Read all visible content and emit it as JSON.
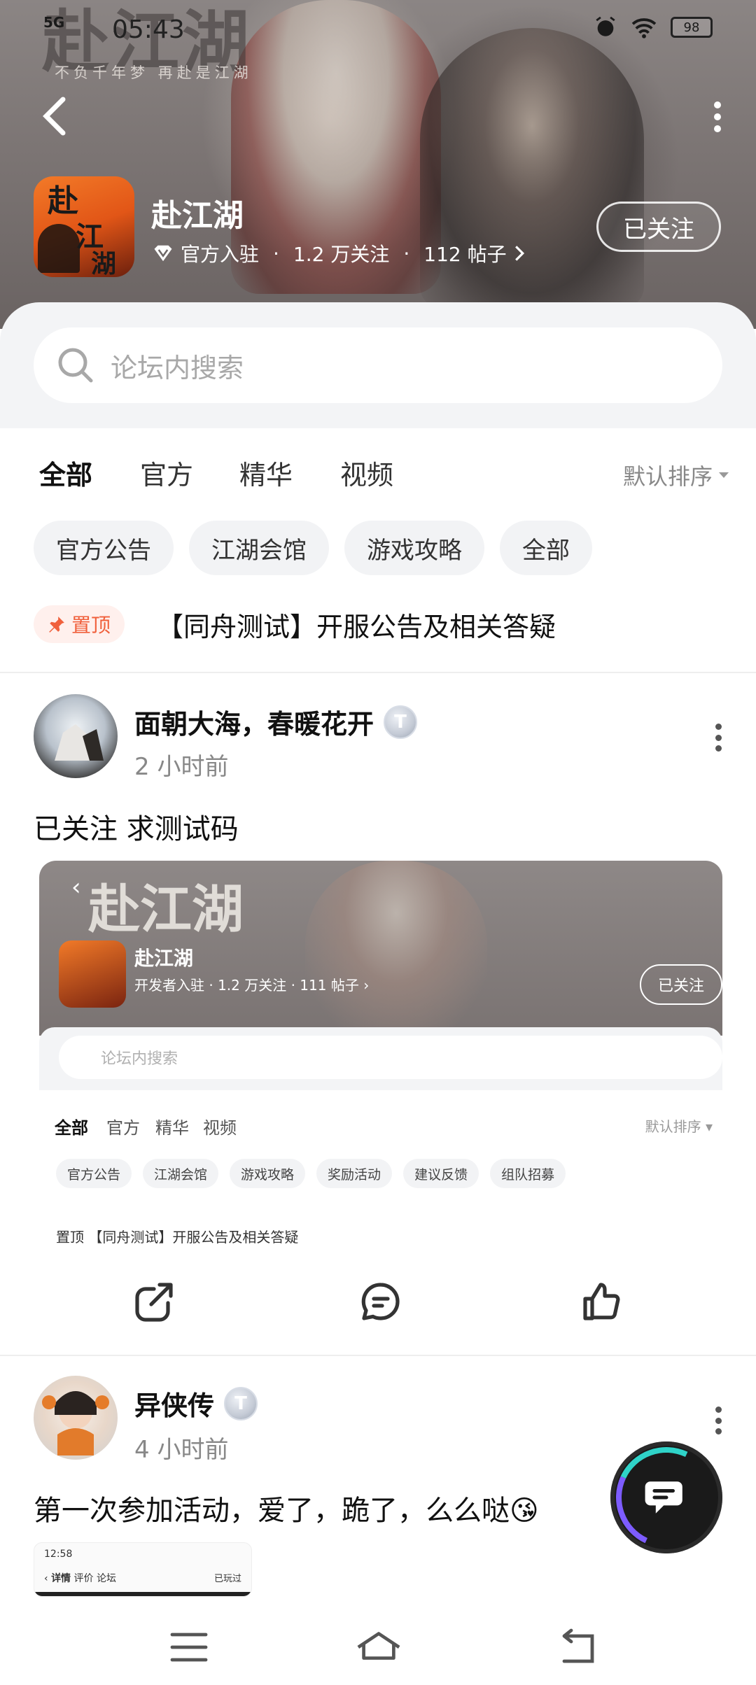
{
  "status_bar": {
    "network": "5G",
    "time": "05:43",
    "battery": "98"
  },
  "banner": {
    "logo_text": "赴江湖",
    "slogan": "不负千年梦 再赴是江湖"
  },
  "forum": {
    "app_icon_chars": [
      "赴",
      "江",
      "湖"
    ],
    "title": "赴江湖",
    "official_label": "官方入驻",
    "followers": "1.2 万关注",
    "posts": "112 帖子",
    "follow_button": "已关注"
  },
  "search": {
    "placeholder": "论坛内搜索"
  },
  "tabs": {
    "items": [
      "全部",
      "官方",
      "精华",
      "视频"
    ],
    "active": "全部",
    "sort_label": "默认排序"
  },
  "chips": [
    "官方公告",
    "江湖会馆",
    "游戏攻略",
    "全部"
  ],
  "pinned": {
    "badge": "置顶",
    "title": "【同舟测试】开服公告及相关答疑"
  },
  "posts": [
    {
      "author": "面朝大海，春暖花开",
      "badge": "T",
      "time": "2 小时前",
      "text": "已关注 求测试码",
      "screenshot": {
        "back": "‹",
        "logo": "赴江湖",
        "forum_name": "赴江湖",
        "meta": "开发者入驻 · 1.2 万关注 · 111 帖子 ›",
        "follow": "已关注",
        "search": "论坛内搜索",
        "tabs": [
          "全部",
          "官方",
          "精华",
          "视频"
        ],
        "sort": "默认排序 ▾",
        "chips": [
          "官方公告",
          "江湖会馆",
          "游戏攻略",
          "奖励活动",
          "建议反馈",
          "组队招募"
        ],
        "pinned": "置顶 【同舟测试】开服公告及相关答疑"
      }
    },
    {
      "author": "异侠传",
      "badge": "T",
      "time": "4 小时前",
      "text": "第一次参加活动，爱了，跪了，么么哒😘",
      "screenshot": {
        "time": "12:58",
        "tab_detail": "详情",
        "tab_review": "评价",
        "tab_forum": "论坛",
        "right": "已玩过"
      }
    }
  ],
  "colors": {
    "accent": "#1dc4bd",
    "pin": "#f0603c",
    "pin_bg": "#fff0ed",
    "chip_bg": "#f2f3f5",
    "search_bg": "#f3f4f6"
  },
  "icons": [
    "back-icon",
    "more-icon",
    "search-icon",
    "share-icon",
    "comment-icon",
    "like-icon",
    "chat-icon",
    "menu-icon",
    "home-icon",
    "return-icon"
  ]
}
